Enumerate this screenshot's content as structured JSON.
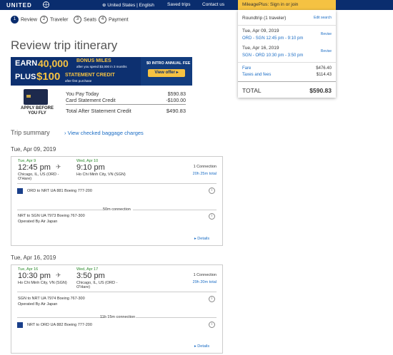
{
  "header": {
    "logo": "UNITED",
    "locale": "United States | English",
    "saved_trips": "Saved trips",
    "contact_us": "Contact us",
    "mileageplus": "MileagePlus: Sign in or join"
  },
  "steps": [
    {
      "num": "1",
      "label": "Review"
    },
    {
      "num": "2",
      "label": "Traveler"
    },
    {
      "num": "3",
      "label": "Seats"
    },
    {
      "num": "4",
      "label": "Payment"
    }
  ],
  "page_title": "Review trip itinerary",
  "promo": {
    "earn": "EARN",
    "miles": "40,000",
    "bonus": "BONUS MILES",
    "bonus_sub": "after you spend $3,000 in 3 months",
    "plus": "PLUS",
    "credit_amt": "$100",
    "credit": "STATEMENT CREDIT",
    "credit_sub": "after first purchase",
    "fee": "$0 INTRO ANNUAL FEE",
    "view_offer": "View offer ▸"
  },
  "apply": "APPLY BEFORE YOU FLY",
  "card_summary": {
    "you_pay_label": "You Pay Today",
    "you_pay_value": "$590.83",
    "credit_label": "Card Statement Credit",
    "credit_value": "-$100.00",
    "after_label": "Total After Statement Credit",
    "after_value": "$490.83"
  },
  "summary": {
    "title": "Roundtrip (1 traveler)",
    "edit": "Edit search",
    "leg1_date": "Tue, Apr 09, 2019",
    "leg1_route": "ORD - SGN 12:45 pm - 9:10 pm",
    "leg2_date": "Tue, Apr 16, 2019",
    "leg2_route": "SGN - ORD 10:30 pm - 3:50 pm",
    "revise": "Revise",
    "fare_label": "Fare",
    "fare_value": "$476.40",
    "taxes_label": "Taxes and fees",
    "taxes_value": "$114.43",
    "total_label": "TOTAL",
    "total_value": "$590.83"
  },
  "trip_summary": "Trip summary",
  "baggage": "View checked baggage charges",
  "outbound": {
    "date_head": "Tue, Apr 09, 2019",
    "dep_day": "Tue, Apr 9",
    "dep_time": "12:45 pm",
    "dep_place": "Chicago, IL, US (ORD - O'Hare)",
    "arr_day": "Wed, Apr 10",
    "arr_time": "9:10 pm",
    "arr_place": "Ho Chi Minh City, VN (SGN)",
    "connections": "1 Connection",
    "duration": "20h 25m total",
    "seg1": "ORD to NRT     UA 881   Boeing 777-200",
    "layover": "50m connection",
    "seg2": "NRT to SGN     UA 7973  Boeing 767-300",
    "seg2_op": "Operated By Air Japan",
    "details": "Details"
  },
  "inbound": {
    "date_head": "Tue, Apr 16, 2019",
    "dep_day": "Tue, Apr 16",
    "dep_time": "10:30 pm",
    "dep_place": "Ho Chi Minh City, VN (SGN)",
    "arr_day": "Wed, Apr 17",
    "arr_time": "3:50 pm",
    "arr_place": "Chicago, IL, US (ORD - O'Hare)",
    "connections": "1 Connection",
    "duration": "29h 20m total",
    "seg1": "SGN to NRT     UA 7974  Boeing 767-300",
    "seg1_op": "Operated By Air Japan",
    "layover": "11h 15m connection",
    "seg2": "NRT to ORD     UA 882   Boeing 777-200",
    "details": "Details"
  },
  "colors": {
    "navy": "#0a2d6e",
    "gold": "#f5c242",
    "link": "#1a6cc4"
  }
}
